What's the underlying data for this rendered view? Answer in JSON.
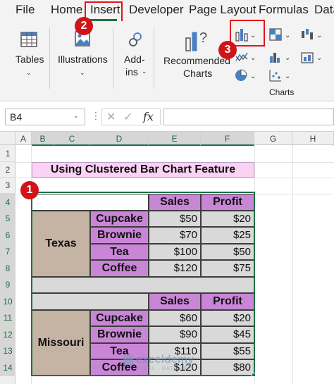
{
  "menu": {
    "tabs": [
      "File",
      "Home",
      "Insert",
      "Developer",
      "Page Layout",
      "Formulas",
      "Data"
    ],
    "active": "Insert"
  },
  "ribbon": {
    "tables": "Tables",
    "illustrations": "Illustrations",
    "addins_line1": "Add-",
    "addins_line2": "ins",
    "recommended_line1": "Recommended",
    "recommended_line2": "Charts",
    "charts_group": "Charts"
  },
  "formula_bar": {
    "name_box": "B4",
    "fx": "fx",
    "value": ""
  },
  "grid": {
    "columns": [
      "A",
      "B",
      "C",
      "D",
      "E",
      "F",
      "G",
      "H"
    ],
    "rows": [
      "1",
      "2",
      "3",
      "4",
      "5",
      "6",
      "7",
      "8",
      "9",
      "10",
      "11",
      "12",
      "13",
      "14"
    ]
  },
  "sheet": {
    "title": "Using Clustered Bar Chart Feature",
    "header_sales": "Sales",
    "header_profit": "Profit",
    "header_sales_2": "Sales",
    "header_profit_2": "Profit",
    "texas": "Texas",
    "missouri": "Missouri",
    "texas_rows": [
      {
        "product": "Cupcake",
        "sales": "$50",
        "profit": "$20"
      },
      {
        "product": "Brownie",
        "sales": "$70",
        "profit": "$25"
      },
      {
        "product": "Tea",
        "sales": "$100",
        "profit": "$50"
      },
      {
        "product": "Coffee",
        "sales": "$120",
        "profit": "$75"
      }
    ],
    "missouri_rows": [
      {
        "product": "Cupcake",
        "sales": "$60",
        "profit": "$20"
      },
      {
        "product": "Brownie",
        "sales": "$90",
        "profit": "$45"
      },
      {
        "product": "Tea",
        "sales": "$110",
        "profit": "$55"
      },
      {
        "product": "Coffee",
        "sales": "$120",
        "profit": "$80"
      }
    ]
  },
  "badges": {
    "one": "1",
    "two": "2",
    "three": "3"
  },
  "watermark": "exceldemy",
  "watermark_sub": "EXCEL · DATA · BI",
  "colors": {
    "accent_green": "#1e7145",
    "callout_red": "#d1141a",
    "header_purple": "#c986d6",
    "title_pink": "#fbd2f4",
    "state_tan": "#c5b3a3"
  }
}
